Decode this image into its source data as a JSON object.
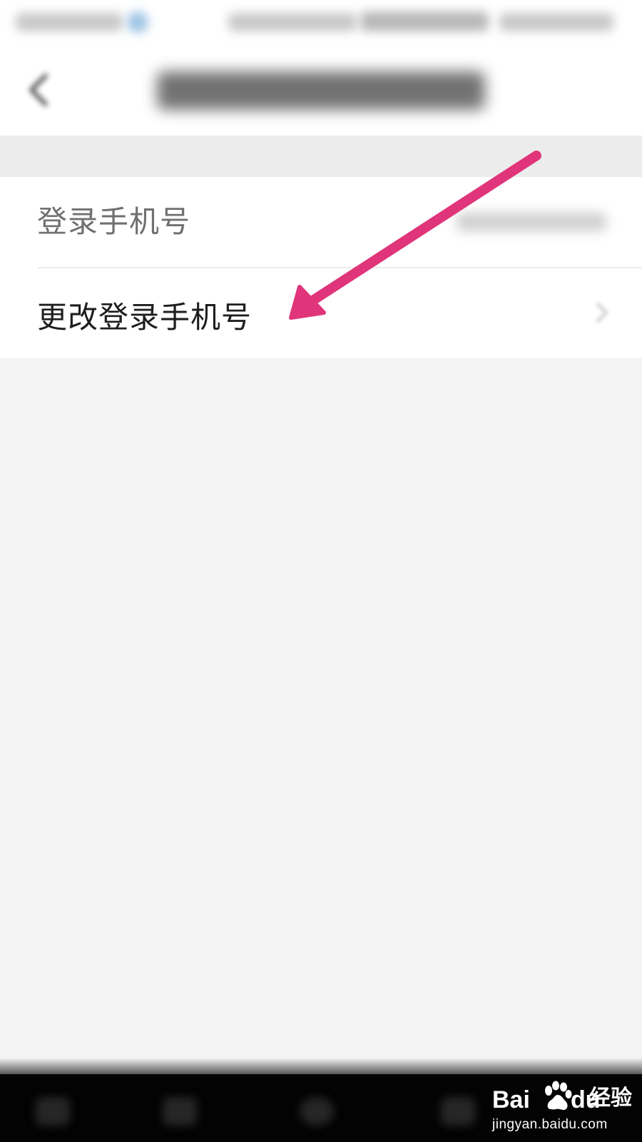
{
  "app": {
    "accent_color": "#e0357a"
  },
  "nav": {
    "back_icon": "chevron-left-icon"
  },
  "settings": {
    "rows": [
      {
        "label": "登录手机号",
        "value_icon": "blurred-phone-number"
      },
      {
        "label": "更改登录手机号",
        "trailing_icon": "chevron-right-icon"
      }
    ]
  },
  "annotation": {
    "icon": "arrow-pointer-icon",
    "color": "#e0357a"
  },
  "watermark": {
    "brand_left": "Bai",
    "brand_right": "du",
    "product": "经验",
    "url": "jingyan.baidu.com"
  }
}
